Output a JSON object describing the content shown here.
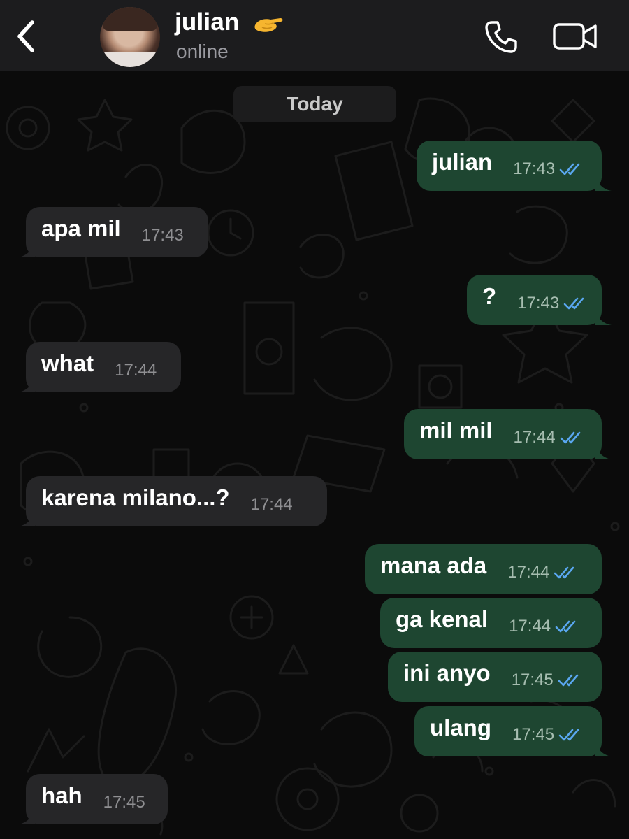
{
  "header": {
    "contact_name": "julian",
    "name_emoji": "pinching-hand-emoji",
    "status": "online",
    "icons": {
      "back": "chevron-left-icon",
      "call": "phone-icon",
      "video": "video-camera-icon"
    }
  },
  "colors": {
    "header_bg": "#1c1c1e",
    "chat_bg": "#0b0b0b",
    "incoming_bubble": "#262628",
    "outgoing_bubble": "#1e4631",
    "read_ticks": "#5aa7f0"
  },
  "chat": {
    "date_label": "Today",
    "messages": [
      {
        "dir": "out",
        "text": "julian",
        "time": "17:43",
        "read": true
      },
      {
        "dir": "in",
        "text": "apa mil",
        "time": "17:43"
      },
      {
        "dir": "out",
        "text": "?",
        "time": "17:43",
        "read": true
      },
      {
        "dir": "in",
        "text": "what",
        "time": "17:44"
      },
      {
        "dir": "out",
        "text": "mil mil",
        "time": "17:44",
        "read": true
      },
      {
        "dir": "in",
        "text": "karena milano...?",
        "time": "17:44"
      },
      {
        "dir": "out",
        "text": "mana ada",
        "time": "17:44",
        "read": true
      },
      {
        "dir": "out",
        "text": "ga kenal",
        "time": "17:44",
        "read": true
      },
      {
        "dir": "out",
        "text": "ini anyo",
        "time": "17:45",
        "read": true
      },
      {
        "dir": "out",
        "text": "ulang",
        "time": "17:45",
        "read": true
      },
      {
        "dir": "in",
        "text": "hah",
        "time": "17:45"
      }
    ]
  }
}
